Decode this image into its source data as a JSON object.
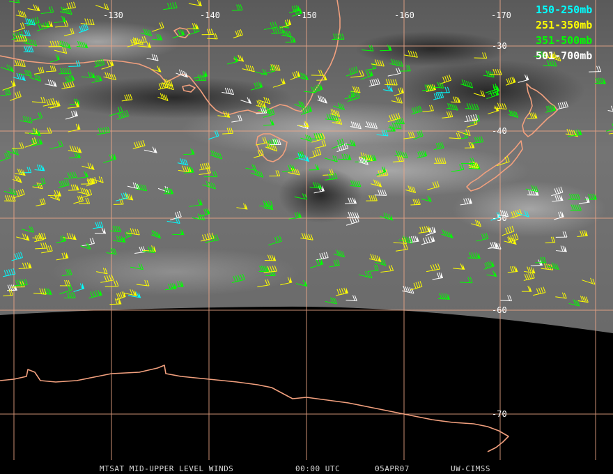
{
  "colors": {
    "graticule": "#f0a888",
    "coast": "#f2a07e",
    "sat_dark": "#3a3a3a",
    "sat_mid": "#6e6e6e",
    "sat_light": "#9a9a9a",
    "space": "#000000"
  },
  "longitude_labels": [
    "-130",
    "-140",
    "-150",
    "-160",
    "-170"
  ],
  "latitude_labels": [
    "-30",
    "-40",
    "-50",
    "-60",
    "-70"
  ],
  "legend": [
    {
      "label": "150-250mb",
      "color": "#00ffff"
    },
    {
      "label": "251-350mb",
      "color": "#ffff00"
    },
    {
      "label": "351-500mb",
      "color": "#00ff00"
    },
    {
      "label": "501-700mb",
      "color": "#ffffff"
    }
  ],
  "footer": {
    "product": "MTSAT MID-UPPER LEVEL WINDS",
    "time": "00:00 UTC",
    "date": "05APR07",
    "source": "UW-CIMSS"
  }
}
